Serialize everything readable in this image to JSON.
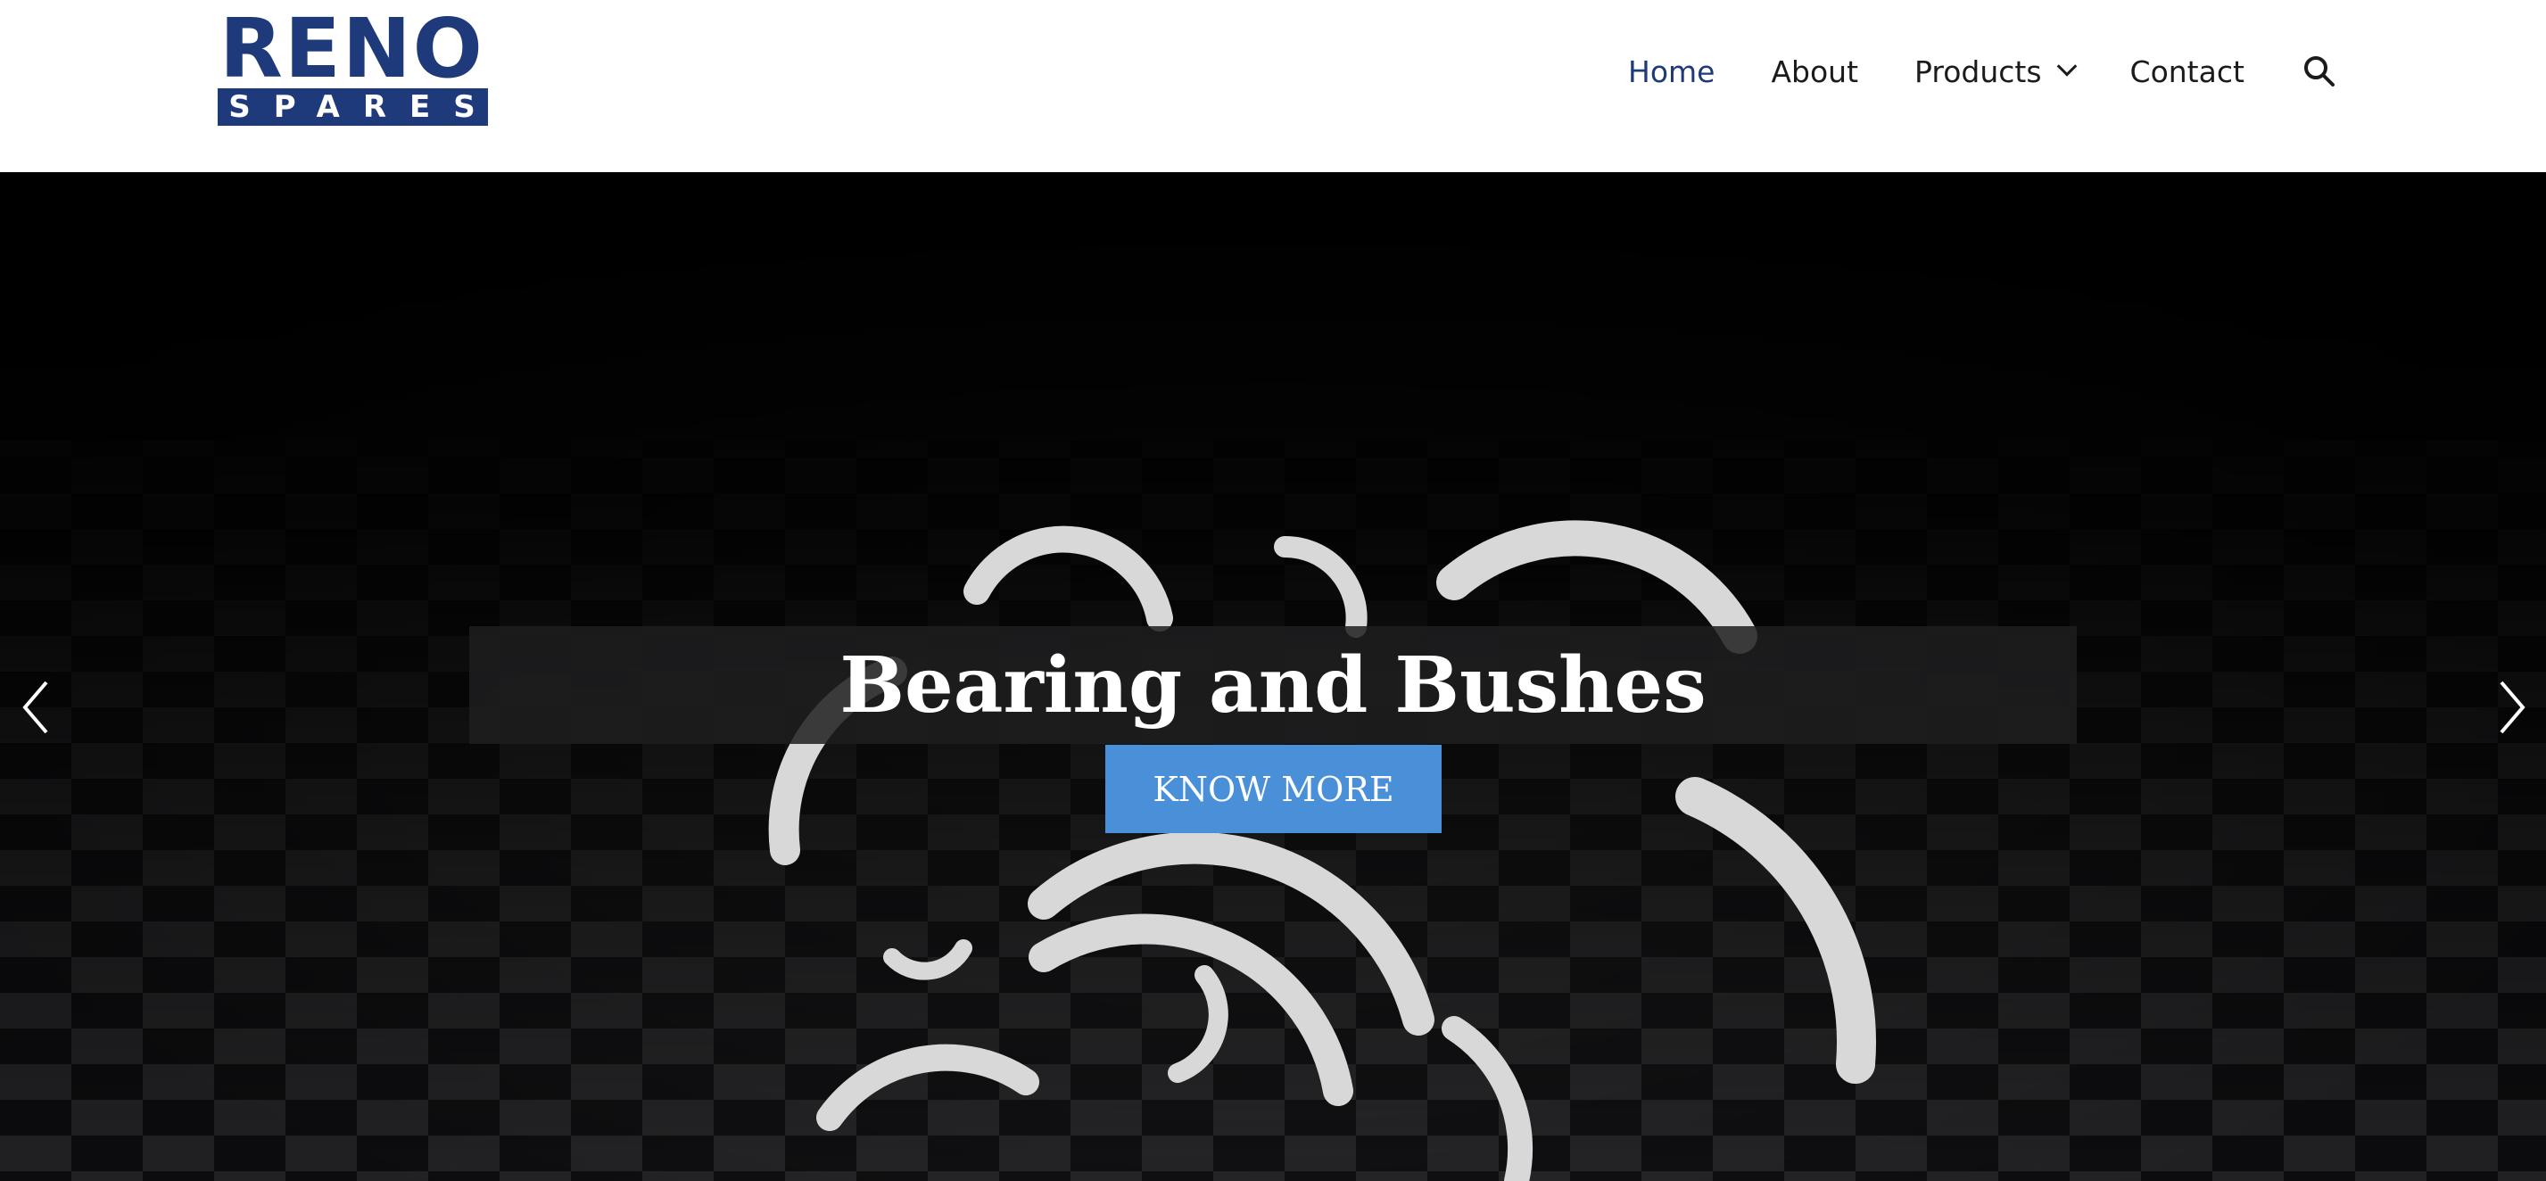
{
  "brand": {
    "name": "RENO",
    "tagline": "SPARES",
    "color": "#1f3a7a"
  },
  "nav": {
    "items": [
      {
        "label": "Home",
        "active": true
      },
      {
        "label": "About",
        "active": false
      },
      {
        "label": "Products",
        "active": false,
        "has_dropdown": true
      },
      {
        "label": "Contact",
        "active": false
      }
    ],
    "search_icon": "search-icon",
    "active_color": "#1f3a7a"
  },
  "hero": {
    "title": "Bearing and Bushes",
    "cta_label": "KNOW MORE",
    "cta_color": "#4a90d9",
    "prev_icon": "chevron-left-icon",
    "next_icon": "chevron-right-icon"
  }
}
